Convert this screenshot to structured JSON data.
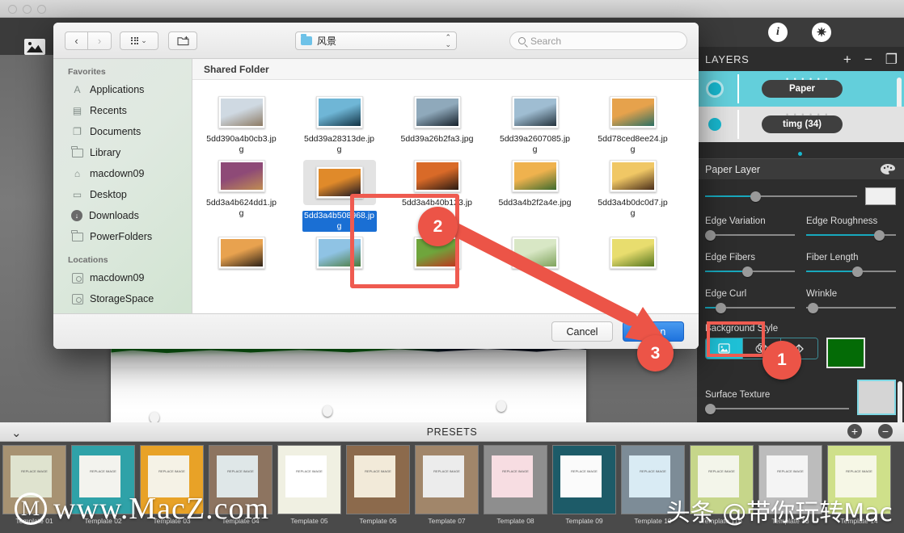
{
  "app": {
    "toolbar": {
      "image_tool": "image-tool",
      "back_arrow": "←"
    },
    "right_panel": {
      "info_icon": "i",
      "settings_icon": "✷",
      "layers_title": "LAYERS",
      "add_label": "+",
      "remove_label": "−",
      "duplicate_label": "❐",
      "layers": [
        {
          "name": "Paper",
          "selected": true
        },
        {
          "name": "timg (34)",
          "selected": false
        }
      ],
      "paper_layer_title": "Paper Layer",
      "opacity_slider": {
        "value": 32
      },
      "controls": [
        {
          "label": "Edge Variation",
          "value": 6
        },
        {
          "label": "Edge Roughness",
          "value": 80
        },
        {
          "label": "Edge Fibers",
          "value": 45
        },
        {
          "label": "Fiber Length",
          "value": 55
        },
        {
          "label": "Edge Curl",
          "value": 22
        },
        {
          "label": "Wrinkle",
          "value": 12
        }
      ],
      "background_style_label": "Background Style",
      "background_style_options": [
        "image-fill-icon",
        "color-blend-icon",
        "paint-bucket-icon"
      ],
      "background_style_selected": 0,
      "background_color": "#046b06",
      "surface_texture_label": "Surface Texture",
      "surface_texture_value": 5,
      "accent_color": "#18b8cf"
    }
  },
  "presets": {
    "title": "PRESETS",
    "collapse_icon": "⌄",
    "add_label": "+",
    "remove_label": "−",
    "items": [
      {
        "label": "Template 01",
        "bg": "#a79272",
        "card": "#dfe3cf"
      },
      {
        "label": "Template 02",
        "bg": "#2fa2a8",
        "card": "#f3f3ee"
      },
      {
        "label": "Template 03",
        "bg": "#e8a227",
        "card": "#f5f2e6"
      },
      {
        "label": "Template 04",
        "bg": "#8d7460",
        "card": "#dfe7e8"
      },
      {
        "label": "Template 05",
        "bg": "#f0f0e2",
        "card": "#ffffff"
      },
      {
        "label": "Template 06",
        "bg": "#8c6a4c",
        "card": "#f2ead9"
      },
      {
        "label": "Template 07",
        "bg": "#a1866a",
        "card": "#ececec"
      },
      {
        "label": "Template 08",
        "bg": "#8e8e8e",
        "card": "#f7dde2"
      },
      {
        "label": "Template 09",
        "bg": "#1d5b68",
        "card": "#fbfbfb"
      },
      {
        "label": "Template 10",
        "bg": "#7d8c97",
        "card": "#d9ebf4"
      },
      {
        "label": "Template 11b",
        "bg": "#c6d68a",
        "card": "#f3f5ea"
      },
      {
        "label": "Template 13",
        "bg": "#bcbcbc",
        "card": "#f4f4f4"
      },
      {
        "label": "Template 14",
        "bg": "#cfe08a",
        "card": "#f6f7e6"
      }
    ]
  },
  "dialog": {
    "back_label": "‹",
    "forward_label": "›",
    "view_label": "⌄",
    "new_folder_label": "⊞",
    "path_label": "风景",
    "stepper_label": "⌃⌄",
    "search_placeholder": "Search",
    "sidebar": {
      "favorites_header": "Favorites",
      "favorites": [
        {
          "label": "Applications",
          "icon": "applications-icon"
        },
        {
          "label": "Recents",
          "icon": "recents-icon"
        },
        {
          "label": "Documents",
          "icon": "documents-icon"
        },
        {
          "label": "Library",
          "icon": "folder-icon"
        },
        {
          "label": "macdown09",
          "icon": "home-icon"
        },
        {
          "label": "Desktop",
          "icon": "desktop-icon"
        },
        {
          "label": "Downloads",
          "icon": "downloads-icon"
        },
        {
          "label": "PowerFolders",
          "icon": "folder-icon"
        }
      ],
      "locations_header": "Locations",
      "locations": [
        {
          "label": "macdown09",
          "icon": "disk-icon"
        },
        {
          "label": "StorageSpace",
          "icon": "disk-icon"
        }
      ]
    },
    "content_header": "Shared Folder",
    "files": [
      [
        {
          "name": "5dd390a4b0cb3.jpg",
          "selected": false,
          "g1": "#cfd9e2",
          "g2": "#8c7a63"
        },
        {
          "name": "5dd39a28313de.jpg",
          "selected": false,
          "g1": "#6fb6d6",
          "g2": "#123243"
        },
        {
          "name": "5dd39a26b2fa3.jpg",
          "selected": false,
          "g1": "#8fa9bb",
          "g2": "#16202a"
        },
        {
          "name": "5dd39a2607085.jpg",
          "selected": false,
          "g1": "#9fbdd2",
          "g2": "#24323c"
        },
        {
          "name": "5dd78ced8ee24.jpg",
          "selected": false,
          "g1": "#e6a24c",
          "g2": "#2b6f63"
        }
      ],
      [
        {
          "name": "5dd3a4b624dd1.jpg",
          "selected": false,
          "g1": "#8e4a77",
          "g2": "#c08d52"
        },
        {
          "name": "5dd3a4b508968.jpg",
          "selected": true,
          "g1": "#e08a2a",
          "g2": "#1a1524"
        },
        {
          "name": "5dd3a4b40b123.jpg",
          "selected": false,
          "g1": "#d96a28",
          "g2": "#2a1a12"
        },
        {
          "name": "5dd3a4b2f2a4e.jpg",
          "selected": false,
          "g1": "#efb24e",
          "g2": "#3d6b2e"
        },
        {
          "name": "5dd3a4b0dc0d7.jpg",
          "selected": false,
          "g1": "#f0c765",
          "g2": "#4a2e1a"
        }
      ],
      [
        {
          "name": "",
          "selected": false,
          "g1": "#e8a24f",
          "g2": "#2c2016"
        },
        {
          "name": "",
          "selected": false,
          "g1": "#8fc3e4",
          "g2": "#4b7a3c"
        },
        {
          "name": "",
          "selected": false,
          "g1": "#6fa53c",
          "g2": "#c2321e"
        },
        {
          "name": "",
          "selected": false,
          "g1": "#d8e7c5",
          "g2": "#7fa35c"
        },
        {
          "name": "",
          "selected": false,
          "g1": "#e8dd6e",
          "g2": "#55761f"
        }
      ]
    ],
    "cancel_label": "Cancel",
    "open_label": "Open"
  },
  "annotations": {
    "step1": "1",
    "step2": "2",
    "step3": "3",
    "highlight_color": "#ef5b50"
  },
  "watermarks": {
    "site": "www.MacZ.com",
    "ring_glyph": "M",
    "toutiao": "头条 @带你玩转Mac"
  }
}
